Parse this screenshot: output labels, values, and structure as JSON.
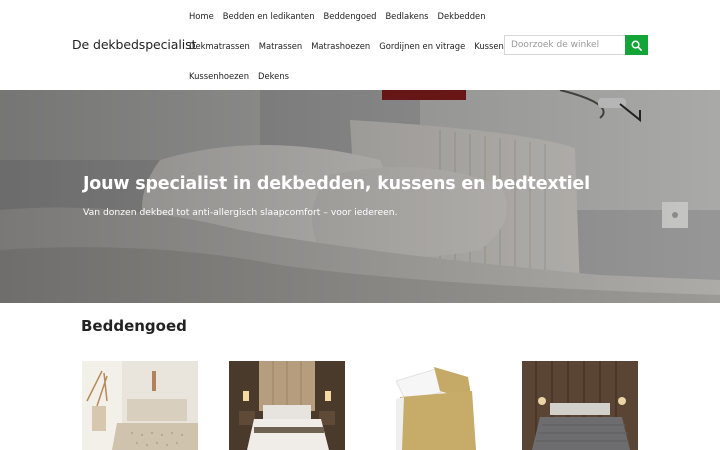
{
  "site": {
    "logo": "De dekbedspecialist"
  },
  "nav": {
    "row1": [
      "Home",
      "Bedden en ledikanten",
      "Beddengoed",
      "Bedlakens",
      "Dekbedden"
    ],
    "row2": [
      "Dekmatrassen",
      "Matrassen",
      "Matrashoezen",
      "Gordijnen en vitrage",
      "Kussens"
    ],
    "row3": [
      "Kussenhoezen",
      "Dekens"
    ]
  },
  "search": {
    "placeholder": "Doorzoek de winkel",
    "button_icon": "search-icon",
    "button_color": "#13a538"
  },
  "hero": {
    "title": "Jouw specialist in dekbedden, kussens en bedtextiel",
    "subtitle": "Van donzen dekbed tot anti-allergisch slaapcomfort – voor iedereen."
  },
  "section": {
    "title": "Beddengoed"
  },
  "products": [
    {
      "image": "bedroom-beige-bedding-image"
    },
    {
      "image": "bedroom-dark-wood-bedding-image"
    },
    {
      "image": "ochre-duvet-cover-image"
    },
    {
      "image": "bedroom-grey-bedding-image"
    }
  ]
}
